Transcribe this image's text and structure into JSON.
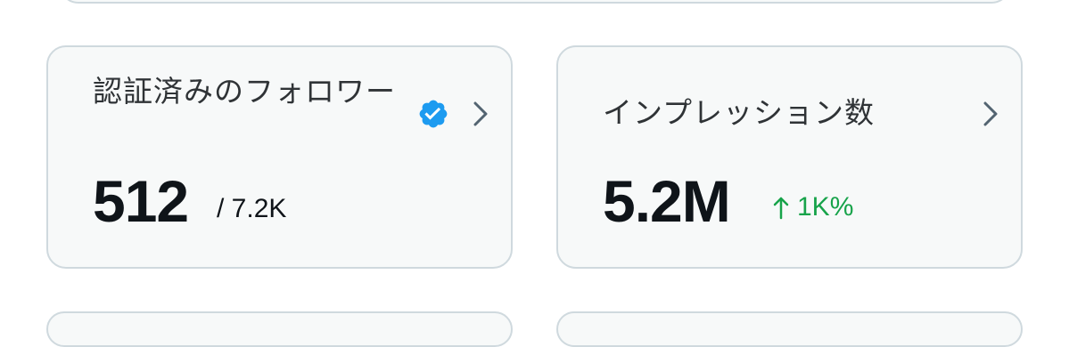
{
  "cards": [
    {
      "title": "認証済みのフォロワー",
      "value": "512",
      "sub_value": "/ 7.2K",
      "icons": [
        "verified-badge-icon",
        "chevron-right-icon"
      ]
    },
    {
      "title": "インプレッション数",
      "value": "5.2M",
      "delta": "1K%",
      "icons": [
        "arrow-up-icon",
        "chevron-right-icon"
      ]
    }
  ],
  "colors": {
    "card_background": "#f7f9f9",
    "card_border": "#cfd9de",
    "verified_badge": "#1d9bf0",
    "delta_positive": "#17a34a",
    "chevron": "#536471"
  }
}
